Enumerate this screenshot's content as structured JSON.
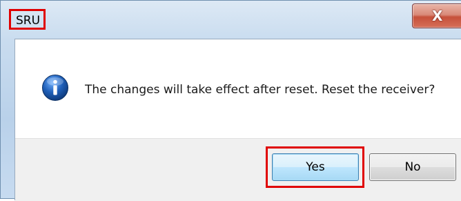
{
  "window": {
    "title": "SRU",
    "close_glyph": "X"
  },
  "dialog": {
    "icon": "info-icon",
    "message": "The changes will take effect after reset. Reset the receiver?"
  },
  "buttons": {
    "yes_label": "Yes",
    "no_label": "No"
  },
  "colors": {
    "highlight": "#e00000",
    "icon_blue": "#1f5fb8"
  }
}
